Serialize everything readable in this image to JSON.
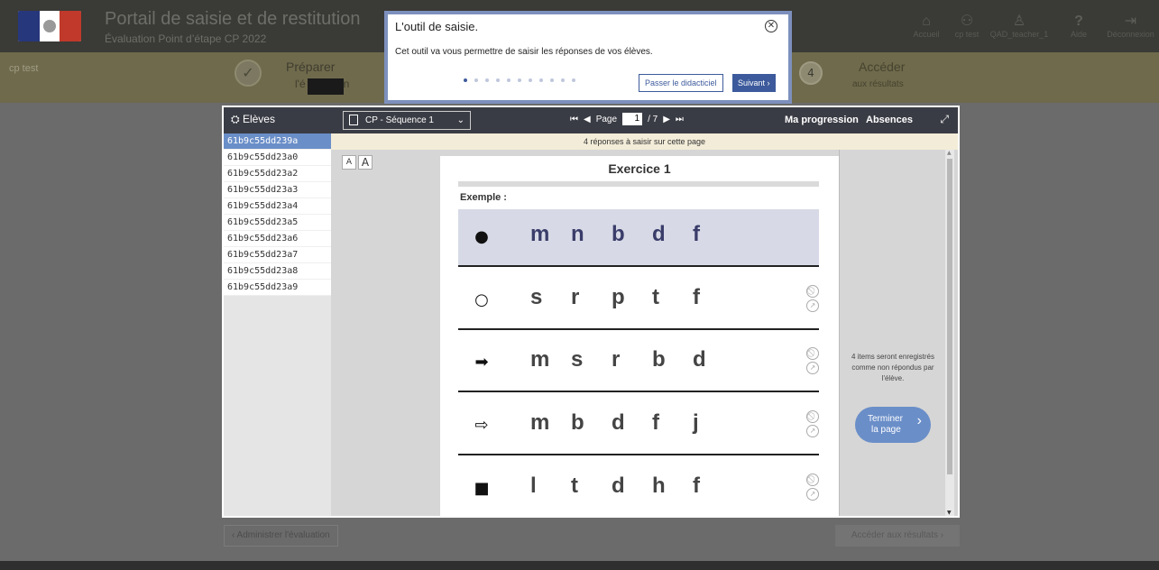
{
  "header": {
    "title": "Portail de saisie et de restitution",
    "subtitle": "Évaluation Point d’étape CP 2022",
    "nav": [
      {
        "label": "Accueil",
        "icon": "home-icon",
        "glyph": "⌂"
      },
      {
        "label": "cp test",
        "icon": "group-icon",
        "glyph": "⚇"
      },
      {
        "label": "QAD_teacher_1",
        "icon": "user-icon",
        "glyph": "♙"
      },
      {
        "label": "Aide",
        "icon": "help-icon",
        "glyph": "?"
      },
      {
        "label": "Déconnexion",
        "icon": "logout-icon",
        "glyph": "⇥"
      }
    ]
  },
  "steps": {
    "class_label": "cp test",
    "step1_line1": "Préparer",
    "step1_line2": "l'é",
    "step1_line2_end": "n",
    "step1_check": "✓",
    "step4_number": "4",
    "step4_line1": "Accéder",
    "step4_line2": "aux résultats"
  },
  "tutorial": {
    "title": "L'outil de saisie.",
    "text": "Cet outil va vous permettre de saisir les réponses de vos élèves.",
    "dots_total": 11,
    "active_dot": 0,
    "skip_label": "Passer le didacticiel",
    "next_label": "Suivant ›",
    "close_glyph": "✕"
  },
  "toolbar": {
    "students_label": "Elèves",
    "sequence": "CP - Séquence 1",
    "page_prefix": "Page",
    "page_current": "1",
    "page_total": "/ 7",
    "progress_label": "Ma progression",
    "absences_label": "Absences"
  },
  "students": [
    "61b9c55dd239a",
    "61b9c55dd23a0",
    "61b9c55dd23a2",
    "61b9c55dd23a3",
    "61b9c55dd23a4",
    "61b9c55dd23a5",
    "61b9c55dd23a6",
    "61b9c55dd23a7",
    "61b9c55dd23a8",
    "61b9c55dd23a9"
  ],
  "selected_student": 0,
  "notice": "4 réponses à saisir sur cette page",
  "font_buttons": [
    "A",
    "A"
  ],
  "exercise": {
    "title": "Exercice 1",
    "example_label": "Exemple :",
    "rows": [
      {
        "symbol": "●",
        "symbol_name": "filled-circle-icon",
        "letters": [
          "m",
          "n",
          "b",
          "d",
          "f"
        ],
        "example": true
      },
      {
        "symbol": "○",
        "symbol_name": "empty-circle-icon",
        "letters": [
          "s",
          "r",
          "p",
          "t",
          "f"
        ],
        "example": false
      },
      {
        "symbol": "➡",
        "symbol_name": "filled-arrow-icon",
        "letters": [
          "m",
          "s",
          "r",
          "b",
          "d"
        ],
        "example": false
      },
      {
        "symbol": "⇨",
        "symbol_name": "outline-arrow-icon",
        "letters": [
          "m",
          "b",
          "d",
          "f",
          "j"
        ],
        "example": false
      },
      {
        "symbol": "■",
        "symbol_name": "filled-square-icon",
        "letters": [
          "l",
          "t",
          "d",
          "h",
          "f"
        ],
        "example": false
      }
    ]
  },
  "right_panel": {
    "info": "4 items seront enregistrés comme non répondus par l'élève.",
    "finish_line1": "Terminer",
    "finish_line2": "la page"
  },
  "bottom": {
    "admin_label": "‹  Administrer l'évaluation",
    "results_label": "Accéder aux résultats  ›"
  },
  "colors": {
    "accent": "#6a8ec8",
    "tutorial_border": "#7d90bd",
    "toolbar": "#3a3c45",
    "notice_bg": "#f3ecd8"
  }
}
